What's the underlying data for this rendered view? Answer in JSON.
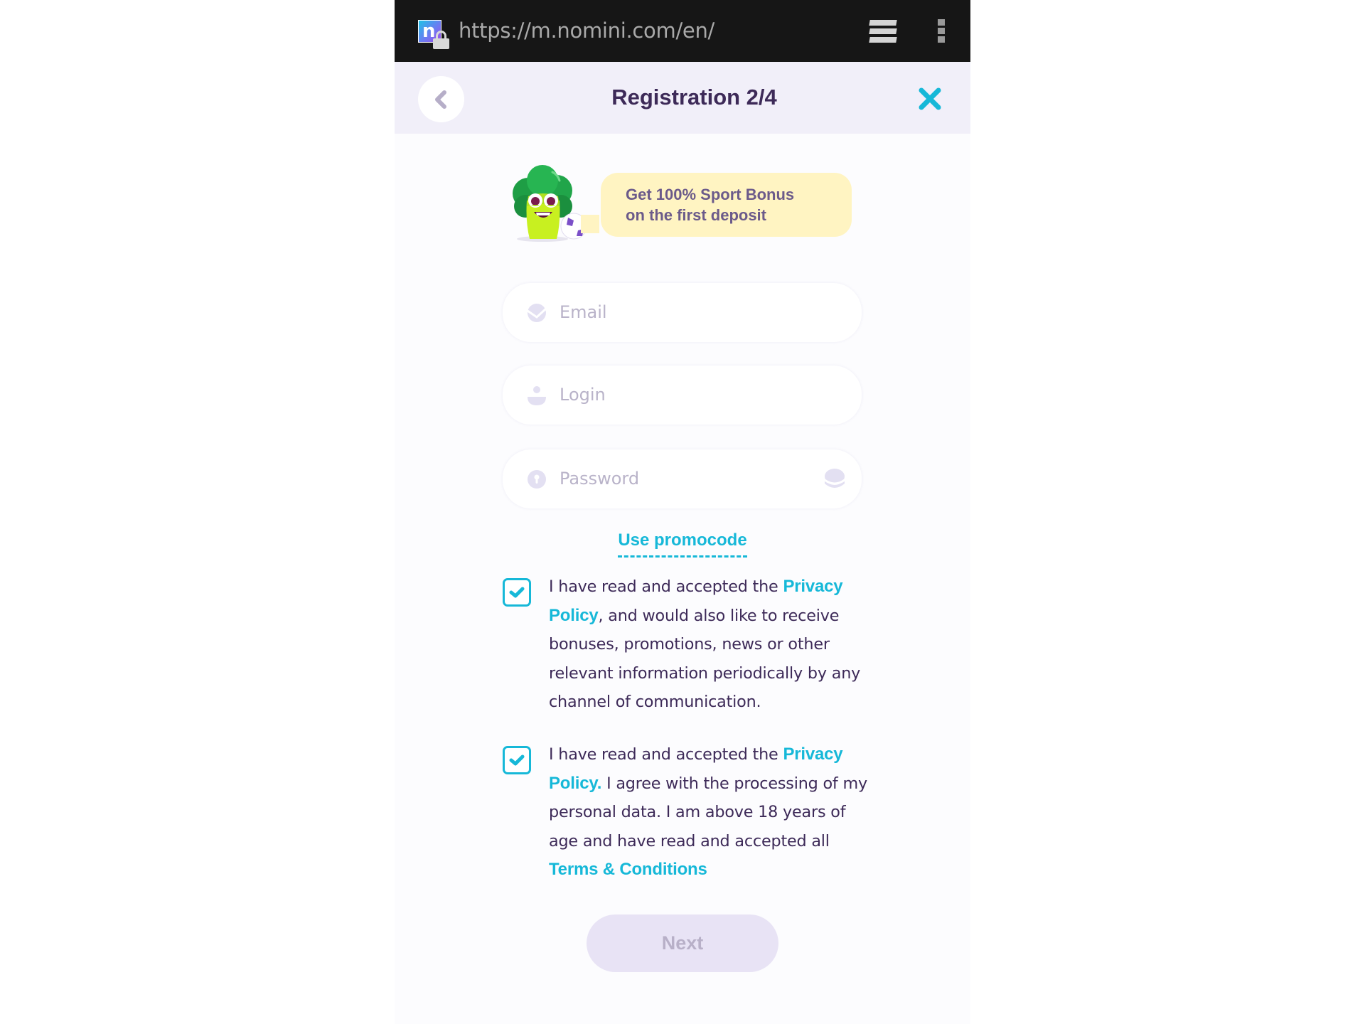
{
  "browser": {
    "url": "https://m.nomini.com/en/",
    "favicon_letter": "n"
  },
  "header": {
    "title": "Registration 2/4",
    "back_icon": "chevron-left-icon",
    "close_icon": "close-icon"
  },
  "promo": {
    "line1": "Get 100% Sport Bonus",
    "line2": "on the first deposit",
    "mascot": "broccoli-mascot"
  },
  "form": {
    "email": {
      "placeholder": "Email",
      "value": "",
      "icon": "email-icon"
    },
    "login": {
      "placeholder": "Login",
      "value": "",
      "icon": "user-icon"
    },
    "password": {
      "placeholder": "Password",
      "value": "",
      "icon": "lock-icon",
      "toggle_icon": "eye-hidden-icon"
    },
    "promocode_label": "Use promocode"
  },
  "consents": [
    {
      "checked": true,
      "text_before": "I have read and accepted the ",
      "link1": "Privacy Policy",
      "text_after": ", and would also like to receive bonuses, promotions, news or other relevant information periodically by any channel of communication."
    },
    {
      "checked": true,
      "text_before": "I have read and accepted the ",
      "link1": "Privacy Policy.",
      "text_middle": " I agree with the processing of my personal data. I am above 18 years of age and have read and accepted all ",
      "link2": "Terms & Conditions"
    }
  ],
  "actions": {
    "next_label": "Next",
    "next_enabled": false
  },
  "colors": {
    "accent": "#16b8d8",
    "title": "#3d2a58",
    "header_bg": "#f1eff9",
    "promo_bg": "#fff4c2",
    "next_bg_disabled": "#e8e3f5"
  }
}
